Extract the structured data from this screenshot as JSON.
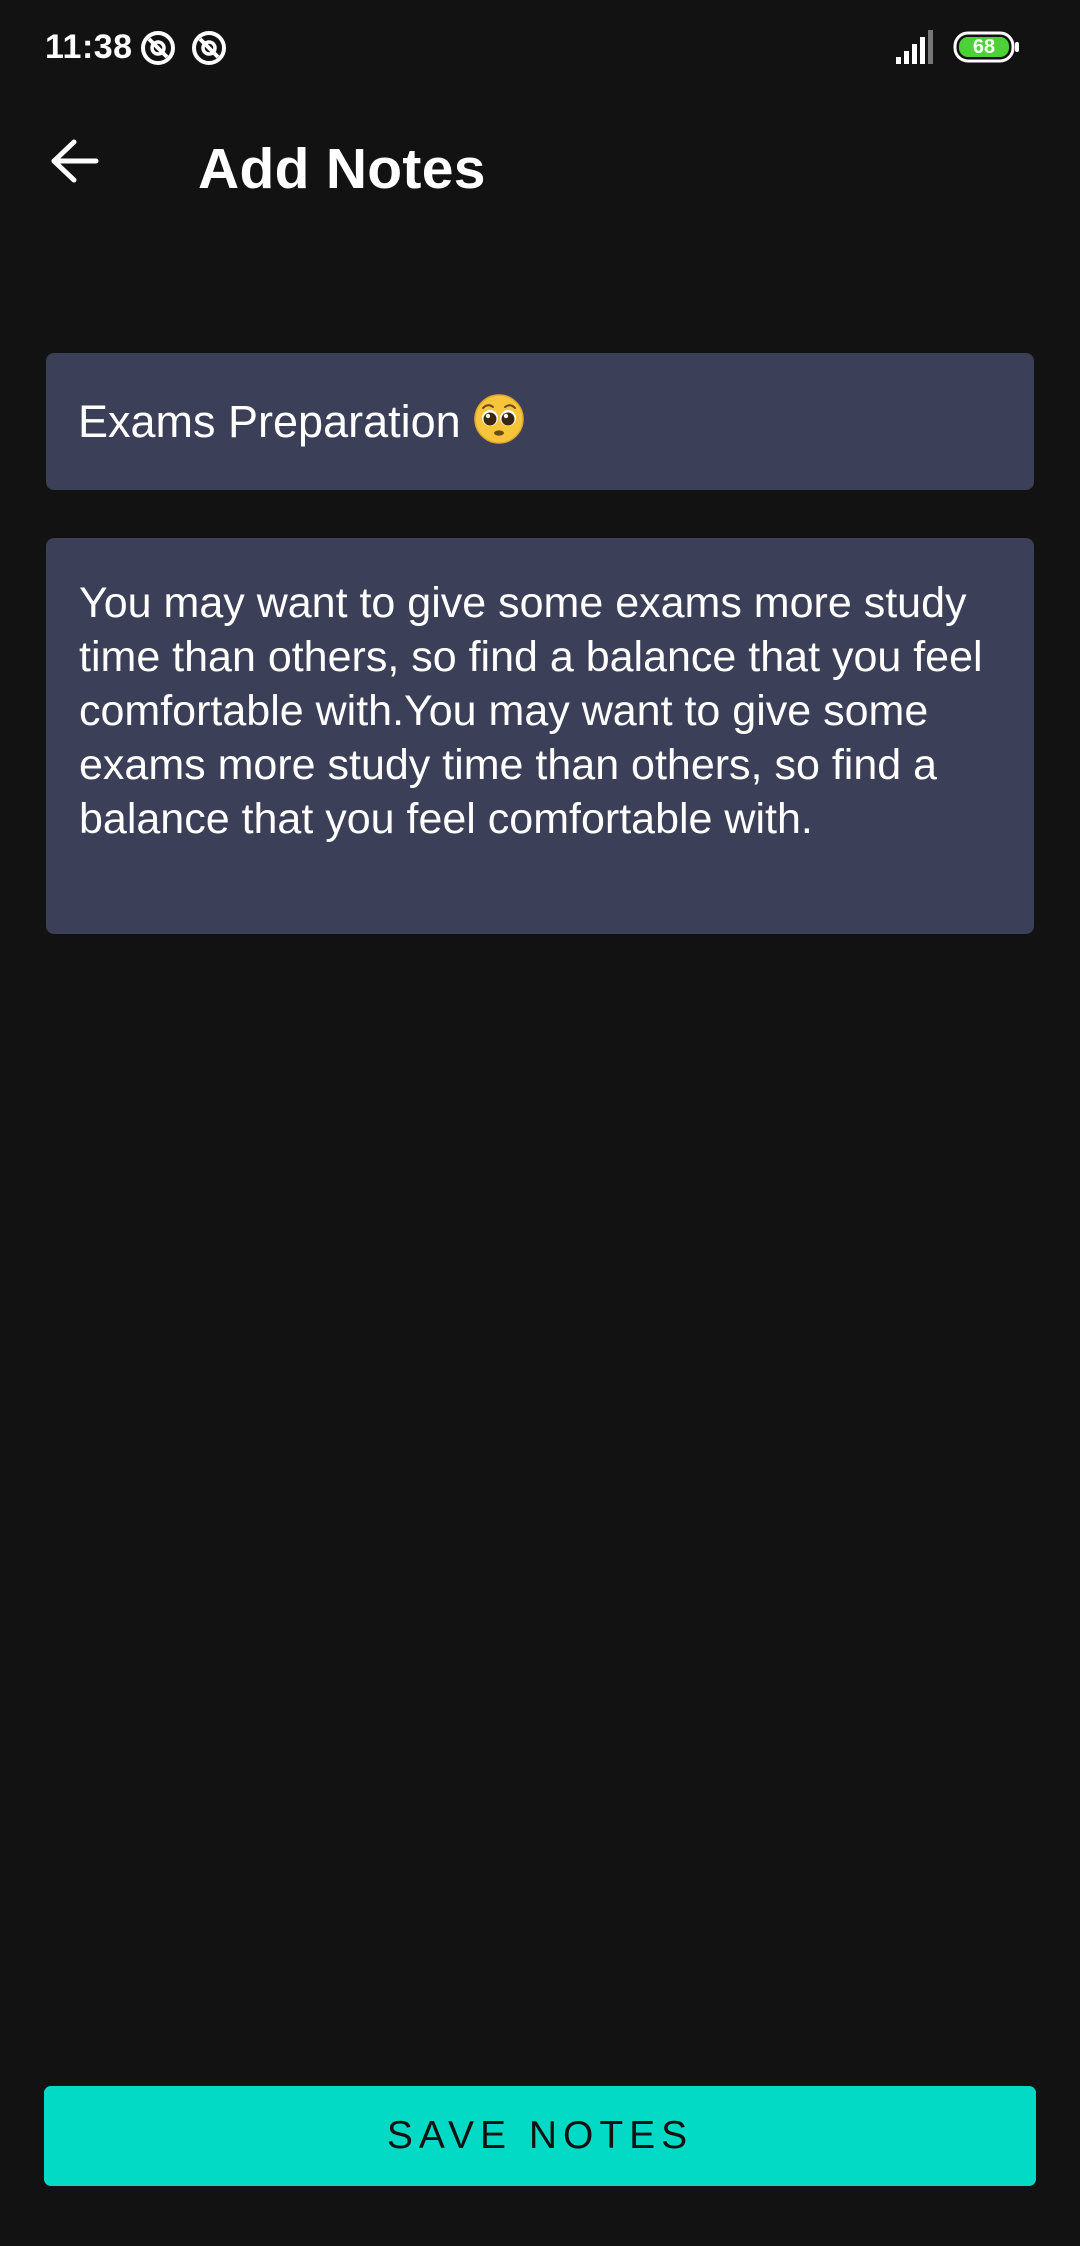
{
  "status_bar": {
    "time": "11:38",
    "battery_level": "68",
    "icons": [
      "app-notification-icon",
      "app-notification-icon",
      "signal-icon",
      "battery-icon"
    ]
  },
  "app_bar": {
    "title": "Add Notes",
    "back_icon": "arrow-left-icon"
  },
  "note": {
    "title_value": "Exams Preparation",
    "title_emoji": "pleading-face-emoji",
    "body_value": "You may want to give some exams more study time than others, so find a balance that you feel comfortable with.You may want to give some exams more study time than others, so find a balance that you feel comfortable with."
  },
  "actions": {
    "save_label": "SAVE NOTES"
  },
  "colors": {
    "background": "#121212",
    "field_background": "#3b3f57",
    "accent": "#03dac6",
    "battery_fill": "#4cd137"
  }
}
